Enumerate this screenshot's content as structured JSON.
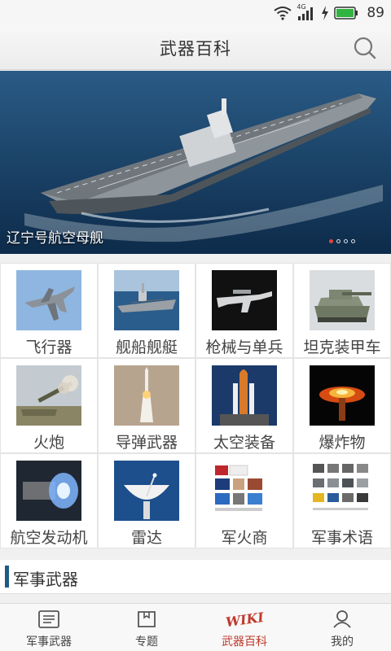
{
  "status": {
    "network": "4G",
    "battery": "89"
  },
  "header": {
    "title": "武器百科"
  },
  "banner": {
    "caption": "辽宁号航空母舰",
    "slide_count": 4,
    "active_slide": 1
  },
  "categories": [
    {
      "label": "飞行器",
      "icon": "fighter-jet"
    },
    {
      "label": "舰船舰艇",
      "icon": "warship"
    },
    {
      "label": "枪械与单兵",
      "icon": "rifle"
    },
    {
      "label": "坦克装甲车",
      "icon": "tank"
    },
    {
      "label": "火炮",
      "icon": "artillery"
    },
    {
      "label": "导弹武器",
      "icon": "missile"
    },
    {
      "label": "太空装备",
      "icon": "space-shuttle"
    },
    {
      "label": "爆炸物",
      "icon": "explosion"
    },
    {
      "label": "航空发动机",
      "icon": "jet-engine"
    },
    {
      "label": "雷达",
      "icon": "radar-dish"
    },
    {
      "label": "军火商",
      "icon": "arms-dealer"
    },
    {
      "label": "军事术语",
      "icon": "military-terms"
    }
  ],
  "section": {
    "title": "军事武器"
  },
  "tabs": [
    {
      "label": "军事武器",
      "icon": "news-icon"
    },
    {
      "label": "专题",
      "icon": "bookmark-icon"
    },
    {
      "label": "武器百科",
      "icon": "wiki-icon",
      "badge": "WIKI",
      "active": true
    },
    {
      "label": "我的",
      "icon": "user-icon"
    }
  ],
  "colors": {
    "accent": "#c0392b",
    "section_bar": "#1f5a84"
  }
}
